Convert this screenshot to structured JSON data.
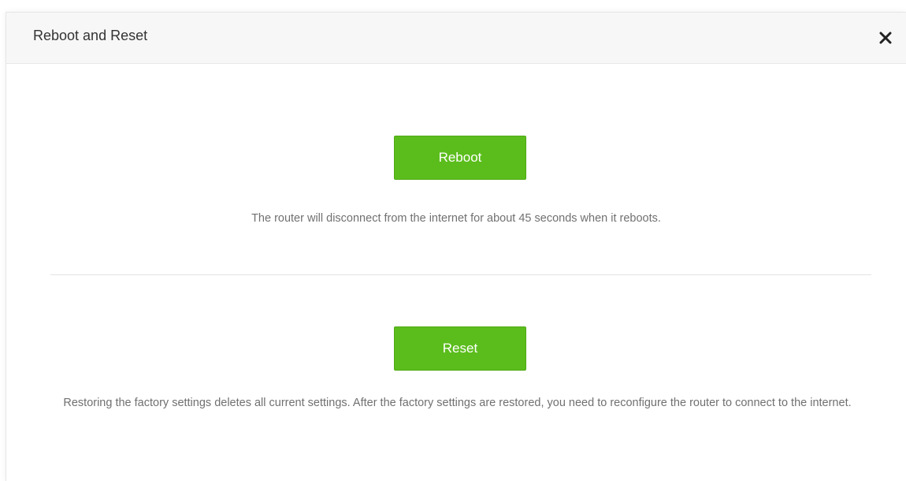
{
  "dialog": {
    "title": "Reboot and Reset",
    "close_icon": "close-icon"
  },
  "reboot": {
    "button_label": "Reboot",
    "description": "The router will disconnect from the internet for about 45 seconds when it reboots."
  },
  "reset": {
    "button_label": "Reset",
    "description": "Restoring the factory settings deletes all current settings. After the factory settings are restored, you need to reconfigure the router to connect to the internet."
  },
  "colors": {
    "accent": "#5bbd1c",
    "header_bg": "#f7f7f7",
    "text": "#707070"
  }
}
